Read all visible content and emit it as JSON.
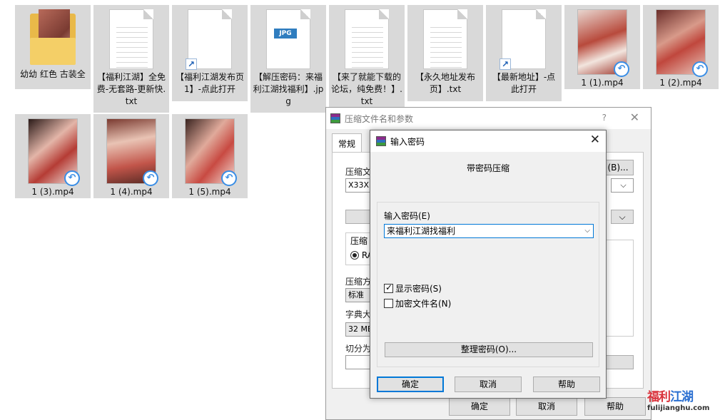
{
  "files": [
    {
      "name": "幼幼 红色 古装全",
      "kind": "folder"
    },
    {
      "name": "【福利江湖】全免费-无套路-更新快.txt",
      "kind": "txt"
    },
    {
      "name": "【福利江湖发布页1】-点此打开",
      "kind": "shortcut"
    },
    {
      "name": "【解压密码：来福利江湖找福利】.jpg",
      "kind": "jpg",
      "badge": "JPG"
    },
    {
      "name": "【来了就能下载的论坛，纯免费！】.txt",
      "kind": "txt"
    },
    {
      "name": "【永久地址发布页】.txt",
      "kind": "txt"
    },
    {
      "name": "【最新地址】-点此打开",
      "kind": "shortcut"
    },
    {
      "name": "1 (1).mp4",
      "kind": "video"
    },
    {
      "name": "1 (2).mp4",
      "kind": "video"
    },
    {
      "name": "1 (3).mp4",
      "kind": "video"
    },
    {
      "name": "1 (4).mp4",
      "kind": "video"
    },
    {
      "name": "1 (5).mp4",
      "kind": "video"
    }
  ],
  "back_dialog": {
    "title": "压缩文件名和参数",
    "help": "?",
    "close": "✕",
    "tab_general": "常规",
    "archive_label": "压缩文",
    "archive_value": "X33XE",
    "browse_button": "(B)...",
    "format_group": "压缩",
    "format_rar": "RA",
    "method_label": "压缩方",
    "method_value": "标准",
    "dict_label": "字典大",
    "dict_value": "32 MB",
    "split_label": "切分为",
    "ok": "确定",
    "cancel": "取消",
    "help_button": "帮助"
  },
  "password_dialog": {
    "title": "输入密码",
    "close": "✕",
    "header": "带密码压缩",
    "password_label": "输入密码(E)",
    "password_value": "来福利江湖找福利",
    "show_password_label": "显示密码(S)",
    "show_password_checked": true,
    "encrypt_names_label": "加密文件名(N)",
    "encrypt_names_checked": false,
    "organize_button": "整理密码(O)...",
    "ok": "确定",
    "cancel": "取消",
    "help": "帮助"
  },
  "watermark": {
    "part1": "福利",
    "part2": "江湖",
    "url": "fulijianghu.com"
  }
}
